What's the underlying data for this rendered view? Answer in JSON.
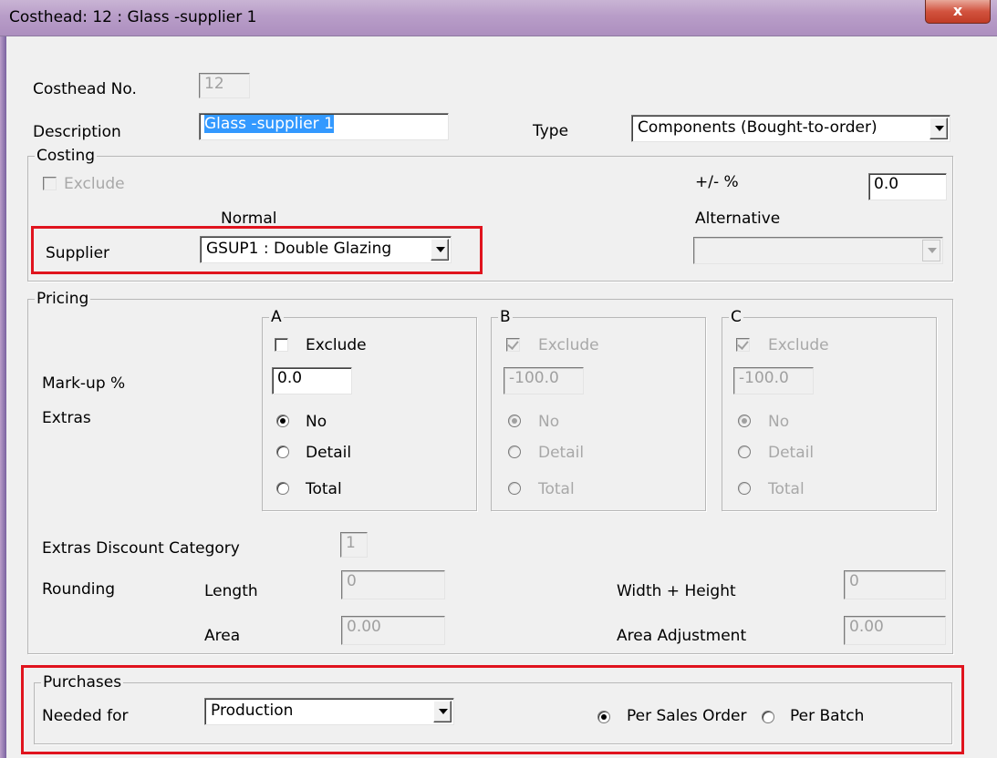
{
  "window": {
    "title": "Costhead: 12  : Glass -supplier 1",
    "close_glyph": "x"
  },
  "colors": {
    "highlight": "#e0141e",
    "selection": "#3399ff",
    "titlebar": "#b89dc8"
  },
  "general": {
    "costhead_no_label": "Costhead No.",
    "costhead_no_value": "12",
    "description_label": "Description",
    "description_value": "Glass -supplier 1",
    "type_label": "Type",
    "type_value": "Components (Bought-to-order)"
  },
  "costing": {
    "group_label": "Costing",
    "exclude_label": "Exclude",
    "exclude_checked": false,
    "plus_minus_label": "+/- %",
    "plus_minus_value": "0.0",
    "normal_label": "Normal",
    "alternative_label": "Alternative",
    "supplier_label": "Supplier",
    "supplier_value": "GSUP1 : Double Glazing",
    "alternative_value": ""
  },
  "pricing": {
    "group_label": "Pricing",
    "markup_label": "Mark-up %",
    "extras_label": "Extras",
    "columns": [
      {
        "label": "A",
        "exclude_label": "Exclude",
        "exclude_checked": false,
        "markup": "0.0",
        "enabled": true,
        "options": [
          "No",
          "Detail",
          "Total"
        ],
        "selected": "No"
      },
      {
        "label": "B",
        "exclude_label": "Exclude",
        "exclude_checked": true,
        "markup": "-100.0",
        "enabled": false,
        "options": [
          "No",
          "Detail",
          "Total"
        ],
        "selected": "No"
      },
      {
        "label": "C",
        "exclude_label": "Exclude",
        "exclude_checked": true,
        "markup": "-100.0",
        "enabled": false,
        "options": [
          "No",
          "Detail",
          "Total"
        ],
        "selected": "No"
      }
    ],
    "extras_discount_label": "Extras Discount Category",
    "extras_discount_value": "1",
    "rounding_label": "Rounding",
    "length_label": "Length",
    "length_value": "0",
    "area_label": "Area",
    "area_value": "0.00",
    "width_height_label": "Width + Height",
    "width_height_value": "0",
    "area_adjustment_label": "Area Adjustment",
    "area_adjustment_value": "0.00"
  },
  "purchases": {
    "group_label": "Purchases",
    "needed_for_label": "Needed for",
    "needed_for_value": "Production",
    "per_sales_order_label": "Per Sales Order",
    "per_batch_label": "Per Batch",
    "selected": "Per Sales Order"
  }
}
